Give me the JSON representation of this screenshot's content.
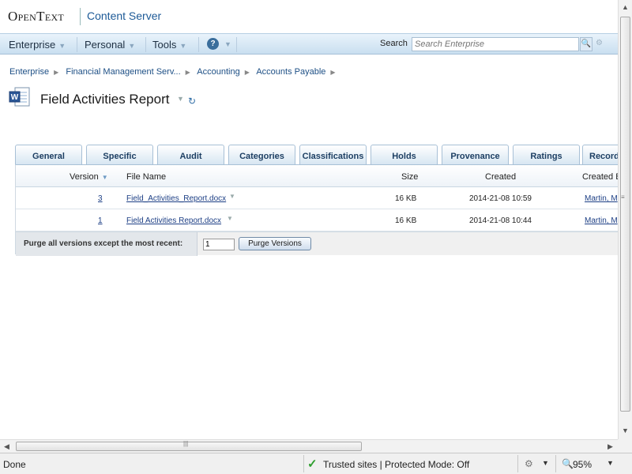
{
  "header": {
    "logo": "OpenText",
    "product": "Content Server"
  },
  "nav": {
    "items": [
      {
        "label": "Enterprise"
      },
      {
        "label": "Personal"
      },
      {
        "label": "Tools"
      }
    ],
    "help_symbol": "?",
    "search_label": "Search",
    "search_placeholder": "Search Enterprise"
  },
  "breadcrumb": [
    "Enterprise",
    "Financial Management Serv...",
    "Accounting",
    "Accounts Payable"
  ],
  "document": {
    "title": "Field Activities Report",
    "icon": "word-document-icon"
  },
  "tabs": [
    "General",
    "Specific",
    "Audit",
    "Categories",
    "Classifications",
    "Holds",
    "Provenance",
    "Ratings",
    "Records"
  ],
  "versions_table": {
    "columns": [
      "Version",
      "File Name",
      "Size",
      "Created",
      "Created By"
    ],
    "rows": [
      {
        "version": "3",
        "file_name": "Field_Activities_Report.docx",
        "size": "16 KB",
        "created": "2014-21-08 10:59",
        "created_by": "Martin, M"
      },
      {
        "version": "1",
        "file_name": "Field Activities Report.docx",
        "size": "16 KB",
        "created": "2014-21-08 10:44",
        "created_by": "Martin, M"
      }
    ]
  },
  "purge": {
    "label": "Purge all versions except the most recent:",
    "value": "1",
    "button_label": "Purge Versions"
  },
  "statusbar": {
    "left_text": "Done",
    "zone_text": "Trusted sites | Protected Mode: Off",
    "zoom": "95%"
  }
}
